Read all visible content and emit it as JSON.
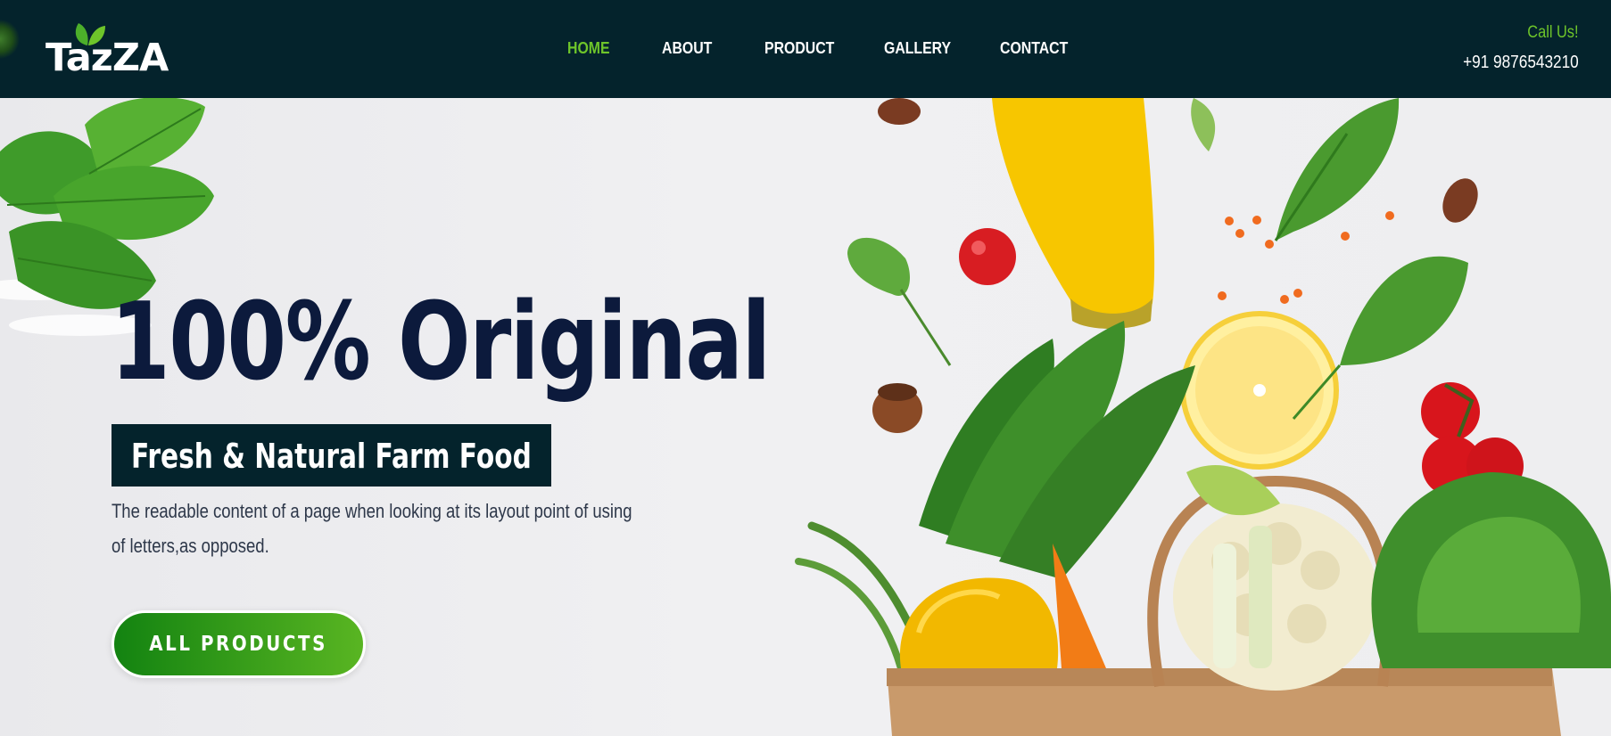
{
  "brand": {
    "name": "TazZA",
    "logo_icon": "leaf-icon"
  },
  "nav": {
    "items": [
      {
        "label": "HOME",
        "active": true
      },
      {
        "label": "ABOUT",
        "active": false
      },
      {
        "label": "PRODUCT",
        "active": false
      },
      {
        "label": "GALLERY",
        "active": false
      },
      {
        "label": "CONTACT",
        "active": false
      }
    ]
  },
  "contact": {
    "label": "Call Us!",
    "phone": "+91 9876543210"
  },
  "hero": {
    "title": "100% Original",
    "subtitle": "Fresh & Natural Farm Food",
    "description": "The readable content of a page when looking at its layout point of using of letters,as opposed.",
    "cta_label": "ALL PRODUCTS"
  },
  "colors": {
    "header_bg": "#04232c",
    "accent_green": "#6ec52a",
    "title_navy": "#0c1a3c",
    "button_gradient_start": "#138311",
    "button_gradient_end": "#59b522"
  }
}
